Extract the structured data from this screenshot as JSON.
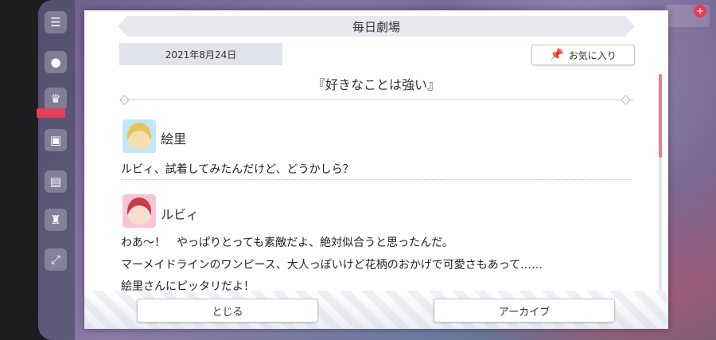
{
  "modal": {
    "title": "毎日劇場",
    "date": "2021年8月24日",
    "favorite_label": "お気に入り",
    "story_title": "『好きなことは強い』"
  },
  "dialogue": [
    {
      "speaker": "絵里",
      "lines": [
        "ルビィ、試着してみたんだけど、どうかしら？"
      ]
    },
    {
      "speaker": "ルビィ",
      "lines": [
        "わあ～！　やっぱりとっても素敵だよ、絶対似合うと思ったんだ。",
        "マーメイドラインのワンピース、大人っぽいけど花柄のおかげで可愛さもあって……",
        "絵里さんにピッタリだよ！"
      ]
    }
  ],
  "buttons": {
    "close_label": "とじる",
    "archive_label": "アーカイブ"
  },
  "icons": {
    "favorite": "pin-icon",
    "menu": "menu-icon",
    "chat": "chat-icon",
    "gift": "gift-icon",
    "present": "present-icon",
    "expand": "expand-icon"
  },
  "colors": {
    "accent": "#f07b8c",
    "title_bar": "#e8e9ee"
  }
}
